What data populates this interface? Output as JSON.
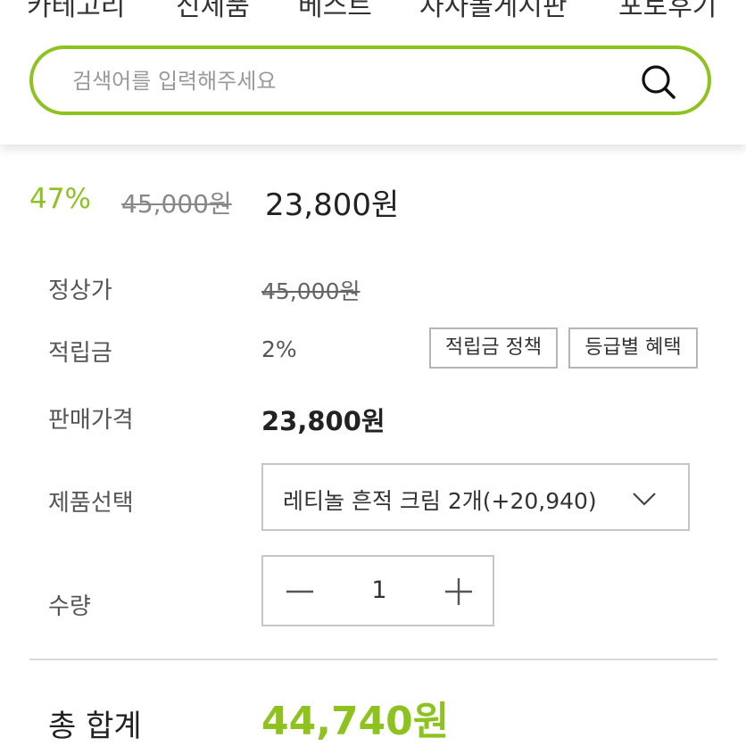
{
  "nav": {
    "items": [
      "카테고리",
      "신제품",
      "베스트",
      "자사몰게시판",
      "포토후기"
    ]
  },
  "search": {
    "placeholder": "검색어를 입력해주세요",
    "icon": "search-icon",
    "border_color": "#8dc21f"
  },
  "summary": {
    "discount": "47%",
    "original_price": "45,000원",
    "sale_price": "23,800원"
  },
  "details": {
    "regular_price_label": "정상가",
    "regular_price": "45,000원",
    "points_label": "적립금",
    "points_value": "2%",
    "points_policy_button": "적립금 정책",
    "grade_benefit_button": "등급별 혜택",
    "selling_price_label": "판매가격",
    "selling_price": "23,800원",
    "option_label": "제품선택",
    "option_selected": "레티놀 흔적 크림 2개(+20,940)",
    "quantity_label": "수량",
    "quantity": "1"
  },
  "total": {
    "label": "총 합계",
    "value": "44,740원"
  },
  "colors": {
    "accent": "#8dc21f"
  }
}
